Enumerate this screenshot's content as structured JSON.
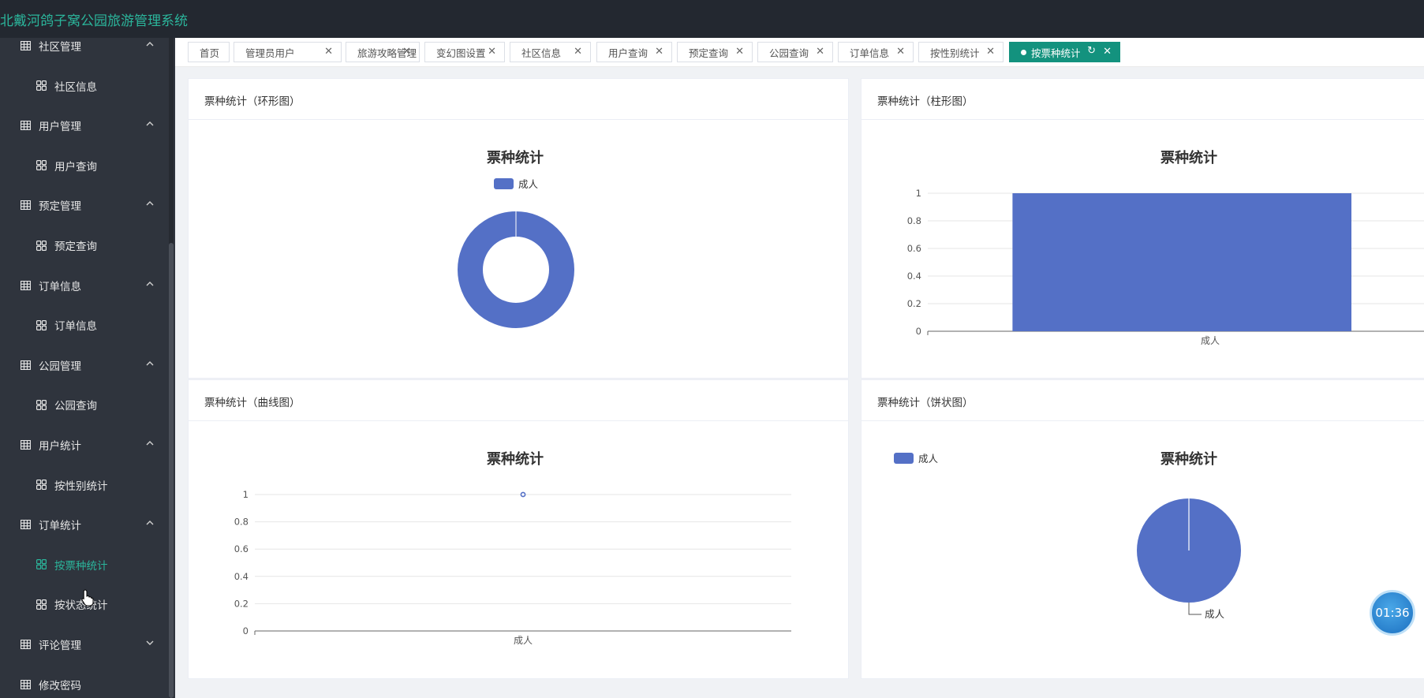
{
  "app": {
    "title": "北戴河鸽子窝公园旅游管理系统"
  },
  "sidebar": {
    "items": [
      {
        "label": "社区管理",
        "type": "group",
        "expanded": true
      },
      {
        "label": "社区信息",
        "type": "sub"
      },
      {
        "label": "用户管理",
        "type": "group",
        "expanded": true
      },
      {
        "label": "用户查询",
        "type": "sub"
      },
      {
        "label": "预定管理",
        "type": "group",
        "expanded": true
      },
      {
        "label": "预定查询",
        "type": "sub"
      },
      {
        "label": "订单信息",
        "type": "group",
        "expanded": true
      },
      {
        "label": "订单信息",
        "type": "sub"
      },
      {
        "label": "公园管理",
        "type": "group",
        "expanded": true
      },
      {
        "label": "公园查询",
        "type": "sub"
      },
      {
        "label": "用户统计",
        "type": "group",
        "expanded": true
      },
      {
        "label": "按性别统计",
        "type": "sub"
      },
      {
        "label": "订单统计",
        "type": "group",
        "expanded": true
      },
      {
        "label": "按票种统计",
        "type": "sub",
        "active": true
      },
      {
        "label": "按状态统计",
        "type": "sub"
      },
      {
        "label": "评论管理",
        "type": "group",
        "expanded": false
      },
      {
        "label": "修改密码",
        "type": "group"
      }
    ]
  },
  "tabs": [
    {
      "label": "首页",
      "closable": false
    },
    {
      "label": "管理员用户",
      "closable": true
    },
    {
      "label": "旅游攻略管理",
      "closable": true
    },
    {
      "label": "变幻图设置",
      "closable": true
    },
    {
      "label": "社区信息",
      "closable": true
    },
    {
      "label": "用户查询",
      "closable": true
    },
    {
      "label": "预定查询",
      "closable": true
    },
    {
      "label": "公园查询",
      "closable": true
    },
    {
      "label": "订单信息",
      "closable": true
    },
    {
      "label": "按性别统计",
      "closable": true
    },
    {
      "label": "按票种统计",
      "closable": true,
      "active": true
    }
  ],
  "icons": {
    "close": "close-icon",
    "reload": "reload-icon",
    "menu_group": "grid-icon",
    "menu_sub": "apps-icon",
    "chevron": "chevron-icon"
  },
  "colors": {
    "accent": "#13927e",
    "series": "#5470c6",
    "header": "#232830",
    "sidebar": "#2f343d"
  },
  "cards": {
    "donut": {
      "title": "票种统计（环形图）"
    },
    "bar": {
      "title": "票种统计（柱形图）"
    },
    "line": {
      "title": "票种统计（曲线图）"
    },
    "pie": {
      "title": "票种统计（饼状图）"
    }
  },
  "timer": "01:36",
  "chart_data": [
    {
      "type": "pie",
      "variant": "donut",
      "title": "票种统计",
      "legend": [
        "成人"
      ],
      "legend_position": "top-center",
      "labels": [
        "成人"
      ],
      "values": [
        1
      ]
    },
    {
      "type": "bar",
      "title": "票种统计",
      "categories": [
        "成人"
      ],
      "values": [
        1
      ],
      "ylim": [
        0,
        1
      ],
      "yticks": [
        "0",
        "0.2",
        "0.4",
        "0.6",
        "0.8",
        "1"
      ],
      "grid": true
    },
    {
      "type": "line",
      "title": "票种统计",
      "categories": [
        "成人"
      ],
      "values": [
        1
      ],
      "ylim": [
        0,
        1
      ],
      "yticks": [
        "0",
        "0.2",
        "0.4",
        "0.6",
        "0.8",
        "1"
      ],
      "grid": true
    },
    {
      "type": "pie",
      "title": "票种统计",
      "legend": [
        "成人"
      ],
      "legend_position": "top-left",
      "labels": [
        "成人"
      ],
      "values": [
        1
      ]
    }
  ]
}
